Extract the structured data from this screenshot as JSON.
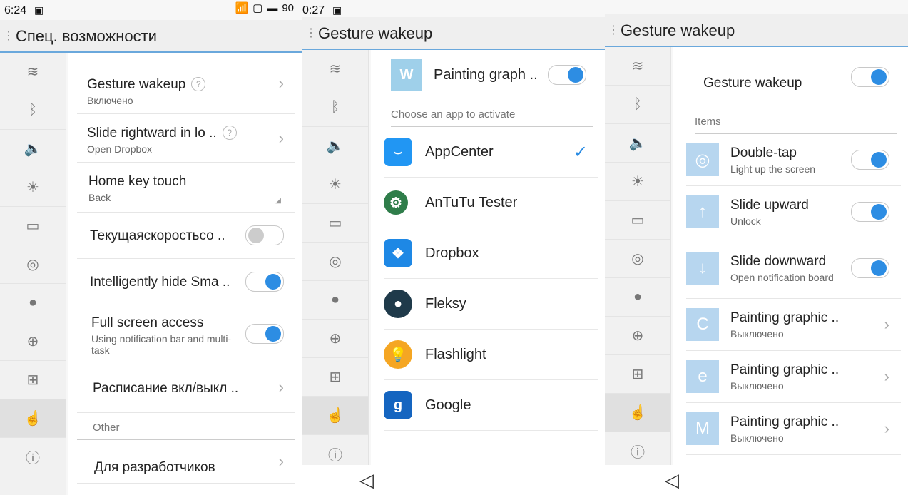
{
  "panel1": {
    "status": {
      "time": "6:24",
      "battery": "90"
    },
    "title": "Спец. возможности",
    "items": [
      {
        "title": "Gesture wakeup",
        "sub": "Включено"
      },
      {
        "title": "Slide rightward in lo ..",
        "sub": "Open Dropbox"
      },
      {
        "title": "Home key touch",
        "sub": "Back"
      },
      {
        "title": "Текущаяскоростьсо .."
      },
      {
        "title": "Intelligently hide Sma .."
      },
      {
        "title": "Full screen access",
        "sub": "Using notification bar and multi-task"
      },
      {
        "title": "Расписание вкл/выкл .."
      }
    ],
    "section_other": "Other",
    "dev": "Для разработчиков"
  },
  "panel2": {
    "status": {
      "time": "0:27"
    },
    "title": "Gesture wakeup",
    "header_app": "Painting graph ..",
    "section": "Choose an app to activate",
    "apps": [
      {
        "name": "AppCenter",
        "color": "#2196f3",
        "icon": "appcenter-icon"
      },
      {
        "name": "AnTuTu Tester",
        "color": "#2f7d4a",
        "icon": "antutu-icon"
      },
      {
        "name": "Dropbox",
        "color": "#1e88e5",
        "icon": "dropbox-icon"
      },
      {
        "name": "Fleksy",
        "color": "#1f3a4a",
        "icon": "fleksy-icon"
      },
      {
        "name": "Flashlight",
        "color": "#f5a623",
        "icon": "flashlight-icon"
      },
      {
        "name": "Google",
        "color": "#1565c0",
        "icon": "google-icon"
      }
    ]
  },
  "panel3": {
    "title": "Gesture wakeup",
    "main_toggle": "Gesture wakeup",
    "section": "Items",
    "items": [
      {
        "title": "Double-tap",
        "sub": "Light up the screen"
      },
      {
        "title": "Slide upward",
        "sub": "Unlock"
      },
      {
        "title": "Slide downward",
        "sub": "Open notification board"
      },
      {
        "title": "Painting graphic ..",
        "sub": "Выключено"
      },
      {
        "title": "Painting graphic ..",
        "sub": "Выключено"
      },
      {
        "title": "Painting graphic ..",
        "sub": "Выключено"
      }
    ]
  }
}
